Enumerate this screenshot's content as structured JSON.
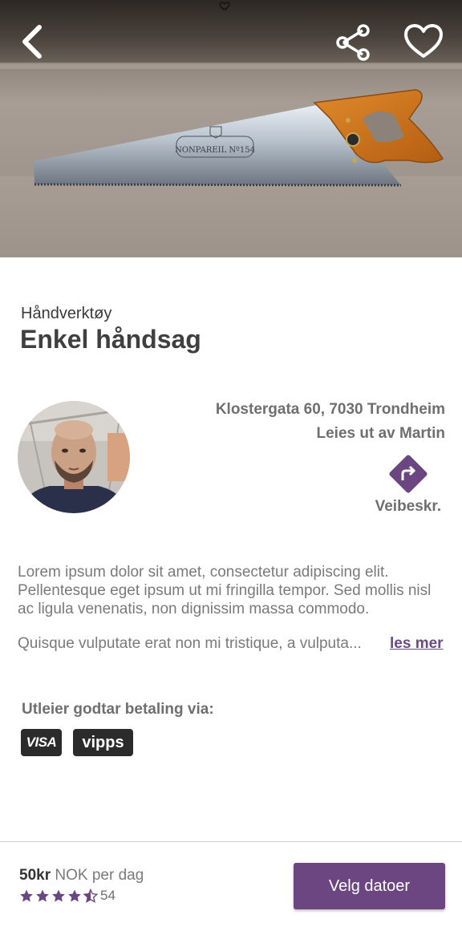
{
  "listing": {
    "category": "Håndverktøy",
    "title": "Enkel håndsag"
  },
  "owner": {
    "address": "Klostergata 60, 7030 Trondheim",
    "lender": "Leies ut av Martin",
    "directions_label": "Veibeskr."
  },
  "description": {
    "paragraph1": "Lorem ipsum dolor sit amet, consectetur adipiscing elit. Pellentesque eget ipsum ut mi fringilla tempor. Sed mollis nisl ac ligula venenatis, non dignissim massa commodo.",
    "paragraph2": "Quisque vulputate erat non mi tristique, a vulputa...",
    "read_more": "les mer"
  },
  "payment": {
    "label": "Utleier godtar betaling via:",
    "methods": [
      "VISA",
      "vipps"
    ]
  },
  "footer": {
    "price_amount": "50kr",
    "price_unit": " NOK per dag",
    "rating_value": 4.5,
    "rating_count": "54",
    "cta_label": "Velg datoer"
  },
  "saw_engraving": {
    "brand": "NONPAREIL Nº154"
  },
  "colors": {
    "accent": "#6b4680",
    "link": "#6c4a82"
  }
}
